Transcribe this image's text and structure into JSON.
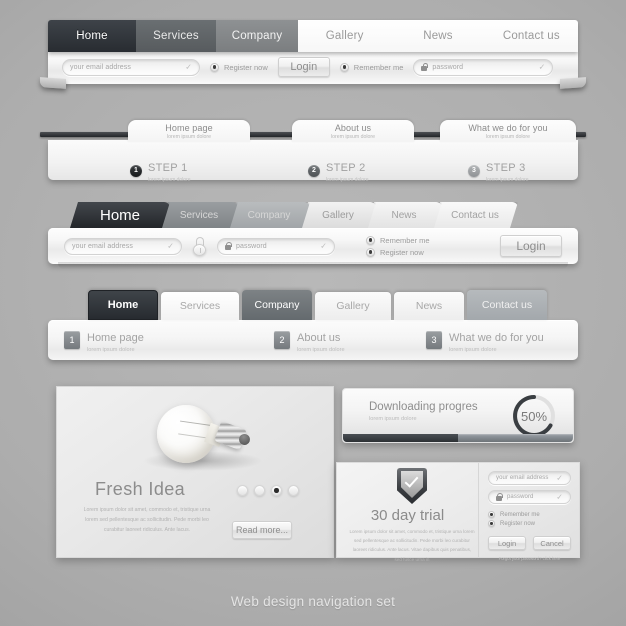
{
  "caption": "Web design navigation set",
  "block1": {
    "name": "flat-navigation-login-bar",
    "tabs": [
      {
        "label": "Home",
        "state": "active-dark"
      },
      {
        "label": "Services",
        "state": "mid"
      },
      {
        "label": "Company",
        "state": "mid-light"
      },
      {
        "label": "Gallery",
        "state": "light"
      },
      {
        "label": "News",
        "state": "light"
      },
      {
        "label": "Contact us",
        "state": "light"
      }
    ],
    "form": {
      "email_placeholder": "your email address",
      "register_label": "Register now",
      "login_label": "Login",
      "remember_label": "Remember me",
      "password_placeholder": "password",
      "tick_glyph": "✓"
    }
  },
  "block2": {
    "name": "ribbon-steps-bar",
    "folds": [
      {
        "title": "Home page",
        "sub": "lorem ipsum dolore"
      },
      {
        "title": "About us",
        "sub": "lorem ipsum dolore"
      },
      {
        "title": "What we do for you",
        "sub": "lorem ipsum dolore"
      }
    ],
    "steps": [
      {
        "num": "1",
        "label": "STEP 1",
        "sub": "lorem ipsum dolore"
      },
      {
        "num": "2",
        "label": "STEP 2",
        "sub": "lorem ipsum dolore"
      },
      {
        "num": "3",
        "label": "STEP 3",
        "sub": "lorem ipsum dolore"
      }
    ]
  },
  "block3": {
    "name": "slanted-tab-login-bar",
    "tabs": [
      {
        "label": "Home"
      },
      {
        "label": "Services"
      },
      {
        "label": "Company"
      },
      {
        "label": "Gallery"
      },
      {
        "label": "News"
      },
      {
        "label": "Contact us"
      }
    ],
    "form": {
      "email_placeholder": "your email address",
      "password_placeholder": "password",
      "remember_label": "Remember me",
      "register_label": "Register now",
      "login_label": "Login",
      "tick_glyph": "✓"
    }
  },
  "block4": {
    "name": "rounded-tab-menu-bar",
    "tabs": [
      {
        "label": "Home"
      },
      {
        "label": "Services"
      },
      {
        "label": "Company"
      },
      {
        "label": "Gallery"
      },
      {
        "label": "News"
      },
      {
        "label": "Contact us"
      }
    ],
    "items": [
      {
        "num": "1",
        "title": "Home page",
        "sub": "lorem ipsum dolore"
      },
      {
        "num": "2",
        "title": "About us",
        "sub": "lorem ipsum dolore"
      },
      {
        "num": "3",
        "title": "What we do for you",
        "sub": "lorem ipsum dolore"
      }
    ]
  },
  "block5": {
    "name": "fresh-idea-slider-panel",
    "headline": "Fresh Idea",
    "body": "Lorem ipsum dolor sit amet, commodo et, tristique urna lorem sed pellentesque ac sollicitudin. Pede morbi leo curabitur laoreet ridiculus. Ante lacus.",
    "read_more_label": "Read more...",
    "dots": 4,
    "active_dot": 3
  },
  "block6": {
    "name": "download-progress-panel",
    "title": "Downloading progres",
    "sub": "lorem ipsum dolore",
    "percent_label": "50%",
    "percent_value": 50
  },
  "block7": {
    "name": "thirty-day-trial-panel",
    "headline": "30 day trial",
    "body": "Lorem ipsum dolor sit amet, commodo et, tristique urna lorem sed pellentesque ac sollicitudin. Pede morbi leo curabitur laoreet ridiculus. Ante lacus. Vitae dapibus quis penatibus, sed fusce urna in",
    "form": {
      "email_placeholder": "your email address",
      "password_placeholder": "password",
      "remember_label": "Remember me",
      "register_label": "Register now",
      "login_label": "Login",
      "cancel_label": "Cancel",
      "forgot_label": "Forgot your password? click here",
      "tick_glyph": "✓"
    }
  },
  "colors": {
    "background": "#a8a8a8",
    "tab_dark": "#2b2f34",
    "tab_mid": "#62676a",
    "tab_light": "#f5f5f5",
    "text_grey": "#9a9a9a",
    "progress_fill": "#33373b"
  }
}
